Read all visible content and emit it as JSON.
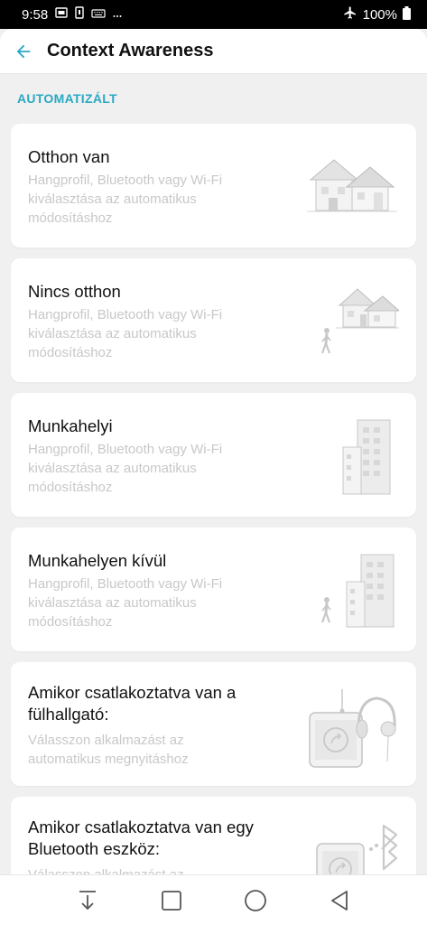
{
  "status_bar": {
    "time": "9:58",
    "battery": "100%",
    "icons": [
      "sim-icon",
      "card-icon",
      "keyboard-icon",
      "more-icon",
      "airplane-icon",
      "battery-icon"
    ]
  },
  "app_bar": {
    "title": "Context Awareness",
    "back_icon": "arrow-left-icon"
  },
  "section": {
    "header": "AUTOMATIZÁLT"
  },
  "cards": [
    {
      "title": "Otthon van",
      "description": "Hangprofil, Bluetooth vagy Wi-Fi kiválasztása az automatikus módosításhoz",
      "icon": "house-icon"
    },
    {
      "title": "Nincs otthon",
      "description": "Hangprofil, Bluetooth vagy Wi-Fi kiválasztása az automatikus módosításhoz",
      "icon": "house-walking-icon"
    },
    {
      "title": "Munkahelyi",
      "description": "Hangprofil, Bluetooth vagy Wi-Fi kiválasztása az automatikus módosításhoz",
      "icon": "office-building-icon"
    },
    {
      "title": "Munkahelyen kívül",
      "description": "Hangprofil, Bluetooth vagy Wi-Fi kiválasztása az automatikus módosításhoz",
      "icon": "office-walking-icon"
    },
    {
      "title": "Amikor csatlakoztatva van a fülhallgató:",
      "description": "Válasszon alkalmazást az automatikus megnyitáshoz",
      "icon": "headphones-app-icon"
    },
    {
      "title": "Amikor csatlakoztatva van egy Bluetooth eszköz:",
      "description": "Válasszon alkalmazást az automatikus megnyitáshoz",
      "icon": "bluetooth-app-icon"
    }
  ],
  "nav_bar": {
    "buttons": [
      "notification-pull-icon",
      "recents-square-icon",
      "home-circle-icon",
      "back-triangle-icon"
    ]
  },
  "colors": {
    "accent": "#29a9c4",
    "background": "#f0f0f0",
    "card": "#ffffff",
    "secondary_text": "#c8c8c8"
  }
}
